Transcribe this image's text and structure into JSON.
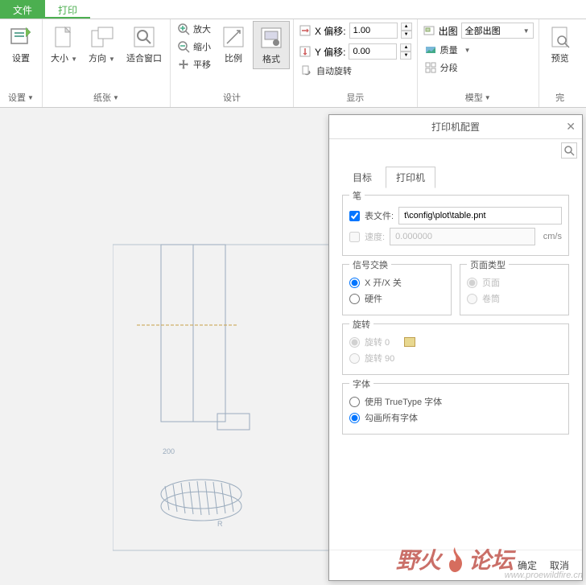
{
  "top_tabs": {
    "file": "文件",
    "print": "打印"
  },
  "ribbon": {
    "settings": {
      "big_label": "设置",
      "group_label": "设置"
    },
    "paper": {
      "size": "大小",
      "orient": "方向",
      "fit": "适合窗口",
      "group_label": "纸张"
    },
    "design": {
      "zoom_in": "放大",
      "zoom_out": "缩小",
      "pan": "平移",
      "scale": "比例",
      "format": "格式",
      "group_label": "设计"
    },
    "display": {
      "x_offset_label": "X 偏移:",
      "x_offset_value": "1.00",
      "y_offset_label": "Y 偏移:",
      "y_offset_value": "0.00",
      "auto_rotate": "自动旋转",
      "group_label": "显示"
    },
    "model": {
      "plot": "出图",
      "plot_select": "全部出图",
      "quality": "质量",
      "segment": "分段",
      "group_label": "模型"
    },
    "finish": {
      "preview": "预览",
      "group_label": "完"
    }
  },
  "dialog": {
    "title": "打印机配置",
    "tabs": {
      "target": "目标",
      "printer": "打印机"
    },
    "pen": {
      "legend": "笔",
      "table_file_label": "表文件:",
      "table_file_value": "t\\config\\plot\\table.pnt",
      "speed_label": "速度:",
      "speed_value": "0.000000",
      "speed_unit": "cm/s"
    },
    "signal": {
      "legend": "信号交换",
      "xonxoff": "X 开/X 关",
      "hardware": "硬件"
    },
    "page_type": {
      "legend": "页面类型",
      "page": "页面",
      "roll": "卷筒"
    },
    "rotate": {
      "legend": "旋转",
      "r0": "旋转 0",
      "r90": "旋转 90"
    },
    "font": {
      "legend": "字体",
      "truetype": "使用 TrueType 字体",
      "draw_all": "勾画所有字体"
    },
    "ok": "确定",
    "cancel": "取消"
  },
  "watermark": {
    "text1": "野火",
    "text2": "论坛",
    "url": "www.proewildfire.cn"
  }
}
